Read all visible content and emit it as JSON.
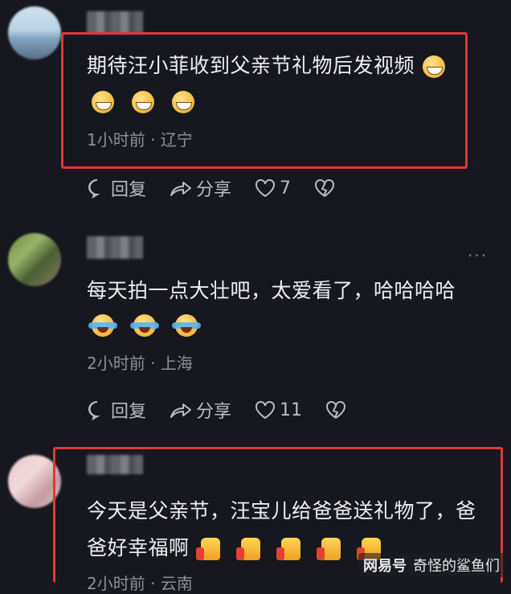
{
  "comments": [
    {
      "text": "期待汪小菲收到父亲节礼物后发视频",
      "emojis": [
        "grin-emoji",
        "grin-emoji",
        "grin-emoji",
        "grin-emoji"
      ],
      "time": "1小时前",
      "location": "辽宁",
      "reply_label": "回复",
      "share_label": "分享",
      "likes": "7"
    },
    {
      "text": "每天拍一点大壮吧，太爱看了，哈哈哈哈",
      "emojis": [
        "joy-emoji",
        "joy-emoji",
        "joy-emoji"
      ],
      "time": "2小时前",
      "location": "上海",
      "reply_label": "回复",
      "share_label": "分享",
      "likes": "11",
      "more": "···"
    },
    {
      "text_line1": "今天是父亲节，汪宝儿给爸爸送礼物了，爸",
      "text_line2": "爸好幸福啊",
      "emojis": [
        "thumbs-up-emoji",
        "thumbs-up-emoji",
        "thumbs-up-emoji",
        "thumbs-up-emoji",
        "thumbs-up-emoji"
      ],
      "time": "2小时前",
      "location": "云南"
    }
  ],
  "meta_separator": "·",
  "highlight_color": "#e0363a",
  "watermark": {
    "brand": "网易号",
    "account": "奇怪的鲨鱼们"
  }
}
